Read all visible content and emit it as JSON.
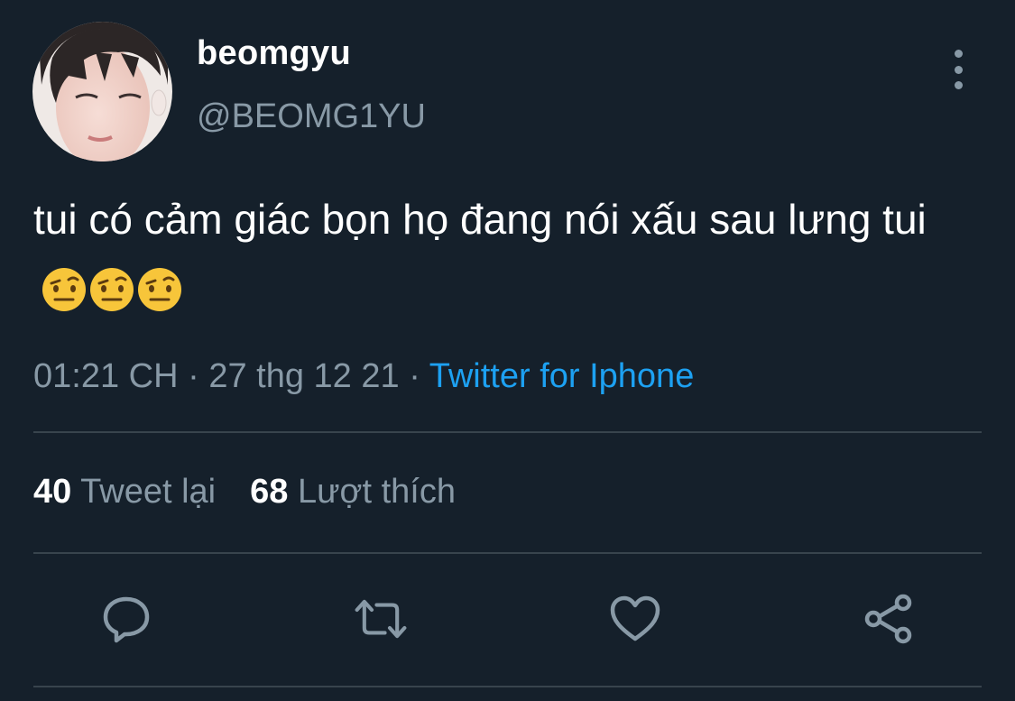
{
  "user": {
    "display_name": "beomgyu",
    "handle": "@BEOMG1YU"
  },
  "tweet": {
    "text": "tui có cảm giác bọn họ đang nói xấu sau lưng tui",
    "emoji": "face-with-raised-eyebrow",
    "emoji_count": 3
  },
  "meta": {
    "time": "01:21 CH",
    "separator": " · ",
    "date": "27 thg 12 21",
    "source": "Twitter for Iphone"
  },
  "stats": {
    "retweets": "40",
    "retweets_label": "Tweet lại",
    "likes": "68",
    "likes_label": "Lượt thích"
  },
  "actions": [
    "reply-icon",
    "retweet-icon",
    "like-icon",
    "share-icon"
  ],
  "colors": {
    "background": "#15202b",
    "text_primary": "#ffffff",
    "text_secondary": "#8899a6",
    "accent": "#1da1f2",
    "divider": "#38444d"
  }
}
